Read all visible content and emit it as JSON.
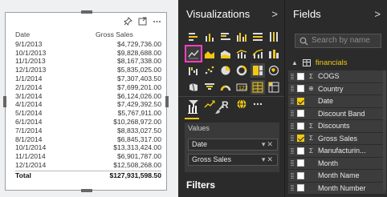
{
  "table_visual": {
    "headers": [
      "Date",
      "Gross Sales"
    ],
    "rows": [
      [
        "9/1/2013",
        "$4,729,736.00"
      ],
      [
        "10/1/2013",
        "$9,828,688.00"
      ],
      [
        "11/1/2013",
        "$8,167,338.00"
      ],
      [
        "12/1/2013",
        "$5,835,025.00"
      ],
      [
        "1/1/2014",
        "$7,307,403.50"
      ],
      [
        "2/1/2014",
        "$7,699,201.00"
      ],
      [
        "3/1/2014",
        "$6,124,026.00"
      ],
      [
        "4/1/2014",
        "$7,429,392.50"
      ],
      [
        "5/1/2014",
        "$5,767,911.00"
      ],
      [
        "6/1/2014",
        "$10,268,972.00"
      ],
      [
        "7/1/2014",
        "$8,833,027.50"
      ],
      [
        "8/1/2014",
        "$6,845,317.00"
      ],
      [
        "10/1/2014",
        "$13,313,424.00"
      ],
      [
        "11/1/2014",
        "$6,901,787.00"
      ],
      [
        "12/1/2014",
        "$12,508,268.00"
      ]
    ],
    "total_label": "Total",
    "total_value": "$127,931,598.50"
  },
  "visualizations": {
    "title": "Visualizations",
    "values_label": "Values",
    "wells": [
      "Date",
      "Gross Sales"
    ],
    "filters_label": "Filters"
  },
  "fields": {
    "title": "Fields",
    "search_placeholder": "Search by name",
    "table_name": "financials",
    "items": [
      {
        "name": "COGS",
        "type": "Σ",
        "checked": false
      },
      {
        "name": "Country",
        "type": "⊕",
        "checked": false
      },
      {
        "name": "Date",
        "type": "",
        "checked": true
      },
      {
        "name": "Discount Band",
        "type": "",
        "checked": false
      },
      {
        "name": "Discounts",
        "type": "Σ",
        "checked": false
      },
      {
        "name": "Gross Sales",
        "type": "Σ",
        "checked": true
      },
      {
        "name": "Manufacturin...",
        "type": "Σ",
        "checked": false
      },
      {
        "name": "Month",
        "type": "",
        "checked": false
      },
      {
        "name": "Month Name",
        "type": "",
        "checked": false
      },
      {
        "name": "Month Number",
        "type": "",
        "checked": false
      }
    ]
  },
  "colors": {
    "accent": "#f2c811",
    "selection": "#ff3fbf",
    "pane_bg": "#2b2b2b"
  }
}
